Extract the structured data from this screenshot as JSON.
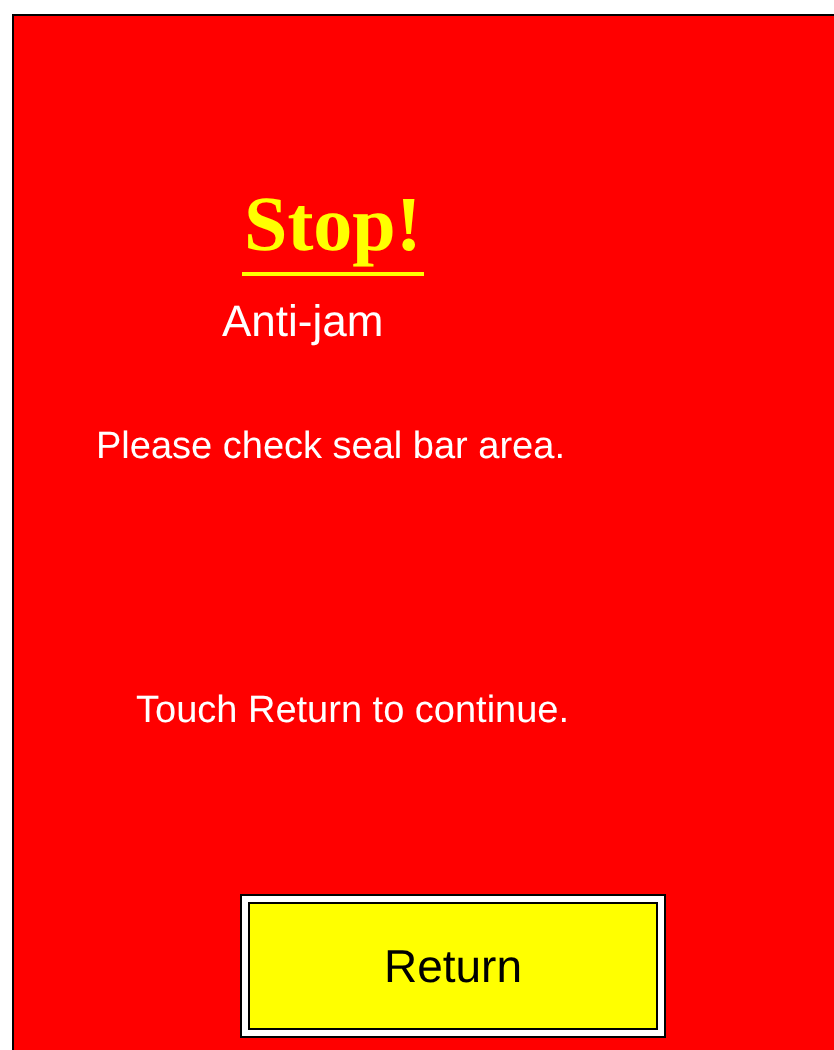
{
  "title": "Stop!",
  "subtitle": "Anti-jam",
  "message": "Please check seal bar area.",
  "instruction": "Touch Return to continue.",
  "button": {
    "label": "Return"
  }
}
